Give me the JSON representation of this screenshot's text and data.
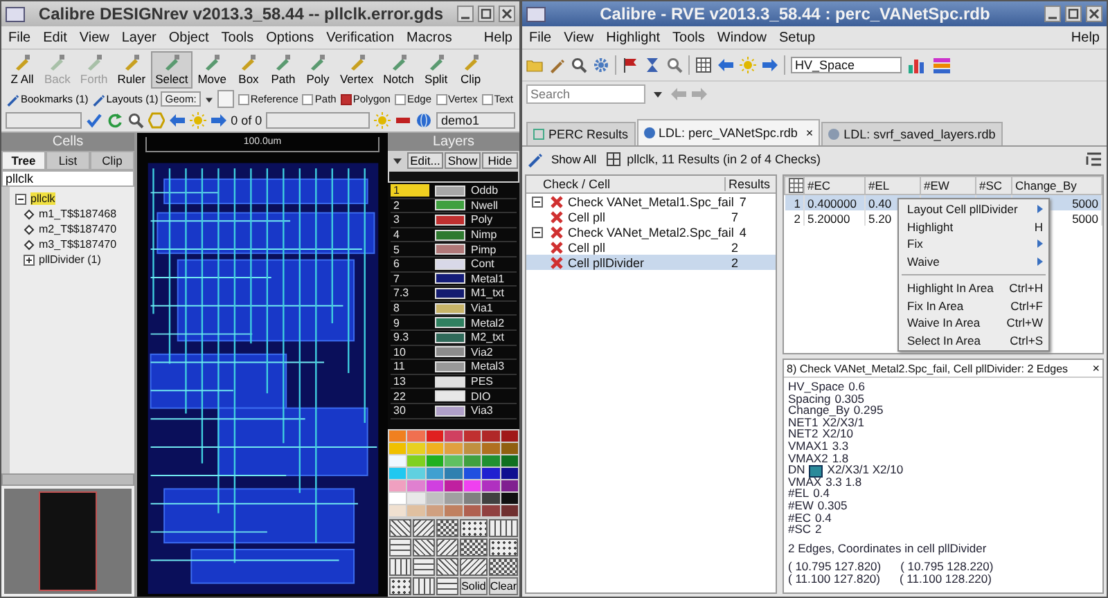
{
  "designrev": {
    "title": "Calibre DESIGNrev v2013.3_58.44  --  pllclk.error.gds",
    "menu": [
      "File",
      "Edit",
      "View",
      "Layer",
      "Object",
      "Tools",
      "Options",
      "Verification",
      "Macros"
    ],
    "help": "Help",
    "tools": [
      {
        "label": "Z All",
        "disabled": false,
        "selected": false
      },
      {
        "label": "Back",
        "disabled": true,
        "selected": false
      },
      {
        "label": "Forth",
        "disabled": true,
        "selected": false
      },
      {
        "label": "Ruler",
        "disabled": false,
        "selected": false
      },
      {
        "label": "Select",
        "disabled": false,
        "selected": true
      },
      {
        "label": "Move",
        "disabled": false,
        "selected": false
      },
      {
        "label": "Box",
        "disabled": false,
        "selected": false
      },
      {
        "label": "Path",
        "disabled": false,
        "selected": false
      },
      {
        "label": "Poly",
        "disabled": false,
        "selected": false
      },
      {
        "label": "Vertex",
        "disabled": false,
        "selected": false
      },
      {
        "label": "Notch",
        "disabled": false,
        "selected": false
      },
      {
        "label": "Split",
        "disabled": false,
        "selected": false
      },
      {
        "label": "Clip",
        "disabled": false,
        "selected": false
      }
    ],
    "bookmarks": "Bookmarks (1)",
    "layouts": "Layouts (1)",
    "geom": "Geom:",
    "filters": [
      {
        "label": "Reference",
        "checked": false
      },
      {
        "label": "Path",
        "checked": false
      },
      {
        "label": "Polygon",
        "checked": true
      },
      {
        "label": "Edge",
        "checked": false
      },
      {
        "label": "Vertex",
        "checked": false
      },
      {
        "label": "Text",
        "checked": false
      }
    ],
    "counter": "0 of 0",
    "layout_select": "demo1",
    "cells": {
      "title": "Cells",
      "tabs": [
        {
          "label": "Tree",
          "selected": true
        },
        {
          "label": "List",
          "selected": false
        },
        {
          "label": "Clip",
          "selected": false
        }
      ],
      "filter": "pllclk",
      "tree": [
        {
          "label": "pllclk",
          "expanded": true,
          "selected": true,
          "children": [
            {
              "label": "m1_T$$187468",
              "expandable": false,
              "selected": false
            },
            {
              "label": "m2_T$$187470",
              "expandable": false,
              "selected": false
            },
            {
              "label": "m3_T$$187470",
              "expandable": false,
              "selected": false
            },
            {
              "label": "pllDivider  (1)",
              "expandable": true,
              "selected": false
            }
          ]
        }
      ]
    },
    "canvas": {
      "scale": "100.0um"
    },
    "layers": {
      "title": "Layers",
      "buttons": [
        "Edit...",
        "Show",
        "Hide"
      ],
      "items": [
        {
          "number": "1",
          "name": "Oddb",
          "color": "#a8a8a8",
          "selected": true
        },
        {
          "number": "2",
          "name": "Nwell",
          "color": "#40a040",
          "selected": false
        },
        {
          "number": "3",
          "name": "Poly",
          "color": "#c03030",
          "selected": false
        },
        {
          "number": "4",
          "name": "Nimp",
          "color": "#2f7a30",
          "selected": false
        },
        {
          "number": "5",
          "name": "Pimp",
          "color": "#b07878",
          "selected": false
        },
        {
          "number": "6",
          "name": "Cont",
          "color": "#d8d8e8",
          "selected": false
        },
        {
          "number": "7",
          "name": "Metal1",
          "color": "#141c78",
          "selected": false
        },
        {
          "number": "7.3",
          "name": "M1_txt",
          "color": "#141c70",
          "selected": false
        },
        {
          "number": "8",
          "name": "Via1",
          "color": "#c8b468",
          "selected": false
        },
        {
          "number": "9",
          "name": "Metal2",
          "color": "#2f8060",
          "selected": false
        },
        {
          "number": "9.3",
          "name": "M2_txt",
          "color": "#306a5a",
          "selected": false
        },
        {
          "number": "10",
          "name": "Via2",
          "color": "#8c8c8c",
          "selected": false
        },
        {
          "number": "11",
          "name": "Metal3",
          "color": "#989898",
          "selected": false
        },
        {
          "number": "13",
          "name": "PES",
          "color": "#e0e0e0",
          "selected": false
        },
        {
          "number": "22",
          "name": "DIO",
          "color": "#e8e8e8",
          "selected": false
        },
        {
          "number": "30",
          "name": "Via3",
          "color": "#b0a0c8",
          "selected": false
        }
      ],
      "pattern_buttons": [
        "Solid",
        "Clear"
      ]
    }
  },
  "rve": {
    "title": "Calibre - RVE v2013.3_58.44 : perc_VANetSpc.rdb",
    "menu": [
      "File",
      "View",
      "Highlight",
      "Tools",
      "Window",
      "Setup"
    ],
    "help": "Help",
    "check_select": "HV_Space",
    "search": {
      "placeholder": "Search"
    },
    "tabs": [
      {
        "label": "PERC Results",
        "selected": false
      },
      {
        "label": "LDL: perc_VANetSpc.rdb",
        "selected": true,
        "close": "×"
      },
      {
        "label": "LDL: svrf_saved_layers.rdb",
        "selected": false
      }
    ],
    "show_all": "Show All",
    "summary": "pllclk, 11 Results (in 2 of 4 Checks)",
    "check_tree": {
      "columns": [
        "Check / Cell",
        "Results"
      ],
      "rows": [
        {
          "label": "Check VANet_Metal1.Spc_fail",
          "results": "7",
          "expanded": true,
          "selected": false,
          "children": [
            {
              "label": "Cell pll",
              "results": "7",
              "selected": false
            }
          ]
        },
        {
          "label": "Check VANet_Metal2.Spc_fail",
          "results": "4",
          "expanded": true,
          "selected": false,
          "children": [
            {
              "label": "Cell pll",
              "results": "2",
              "selected": false
            },
            {
              "label": "Cell pllDivider",
              "results": "2",
              "selected": true
            }
          ]
        }
      ]
    },
    "results_table": {
      "columns": [
        "#EC",
        "#EL",
        "#EW",
        "#SC",
        "Change_By"
      ],
      "rows": [
        {
          "index": "1",
          "cells": [
            "0.400000",
            "0.40"
          ],
          "change_by": "5000",
          "selected": true
        },
        {
          "index": "2",
          "cells": [
            "5.20000",
            "5.20"
          ],
          "change_by": "5000",
          "selected": false
        }
      ]
    },
    "context_menu": [
      {
        "kind": "item",
        "label": "Layout Cell pllDivider",
        "submenu": true
      },
      {
        "kind": "item",
        "label": "Highlight",
        "shortcut": "H",
        "submenu": false
      },
      {
        "kind": "item",
        "label": "Fix",
        "submenu": true
      },
      {
        "kind": "item",
        "label": "Waive",
        "submenu": true
      },
      {
        "kind": "separator"
      },
      {
        "kind": "item",
        "label": "Highlight In Area",
        "shortcut": "Ctrl+H",
        "submenu": false
      },
      {
        "kind": "item",
        "label": "Fix In Area",
        "shortcut": "Ctrl+F",
        "submenu": false
      },
      {
        "kind": "item",
        "label": "Waive In Area",
        "shortcut": "Ctrl+W",
        "submenu": false
      },
      {
        "kind": "item",
        "label": "Select In Area",
        "shortcut": "Ctrl+S",
        "submenu": false
      }
    ],
    "details": {
      "heading": "8) Check VANet_Metal2.Spc_fail, Cell pllDivider: 2 Edges",
      "close": "×",
      "properties": [
        {
          "name": "HV_Space",
          "value": "0.6",
          "marker": false
        },
        {
          "name": "Spacing",
          "value": "0.305",
          "marker": false
        },
        {
          "name": "Change_By",
          "value": "0.295",
          "marker": false
        },
        {
          "name": "NET1",
          "value": "X2/X3/1",
          "marker": false
        },
        {
          "name": "NET2",
          "value": "X2/10",
          "marker": false
        },
        {
          "name": "VMAX1",
          "value": "3.3",
          "marker": false
        },
        {
          "name": "VMAX2",
          "value": "1.8",
          "marker": false
        },
        {
          "name": "DN",
          "value": "X2/X3/1  X2/10",
          "marker": true
        },
        {
          "name": "VMAX",
          "value": "3.3 1.8",
          "marker": false
        },
        {
          "name": "#EL",
          "value": "0.4",
          "marker": false
        },
        {
          "name": "#EW",
          "value": "0.305",
          "marker": false
        },
        {
          "name": "#EC",
          "value": "0.4",
          "marker": false
        },
        {
          "name": "#SC",
          "value": "2",
          "marker": false
        }
      ],
      "edges_title": "2 Edges, Coordinates in cell pllDivider",
      "coordinates": [
        [
          "( 10.795 127.820)",
          "( 10.795 128.220)"
        ],
        [
          "( 11.100 127.820)",
          "( 11.100 128.220)"
        ]
      ]
    }
  }
}
